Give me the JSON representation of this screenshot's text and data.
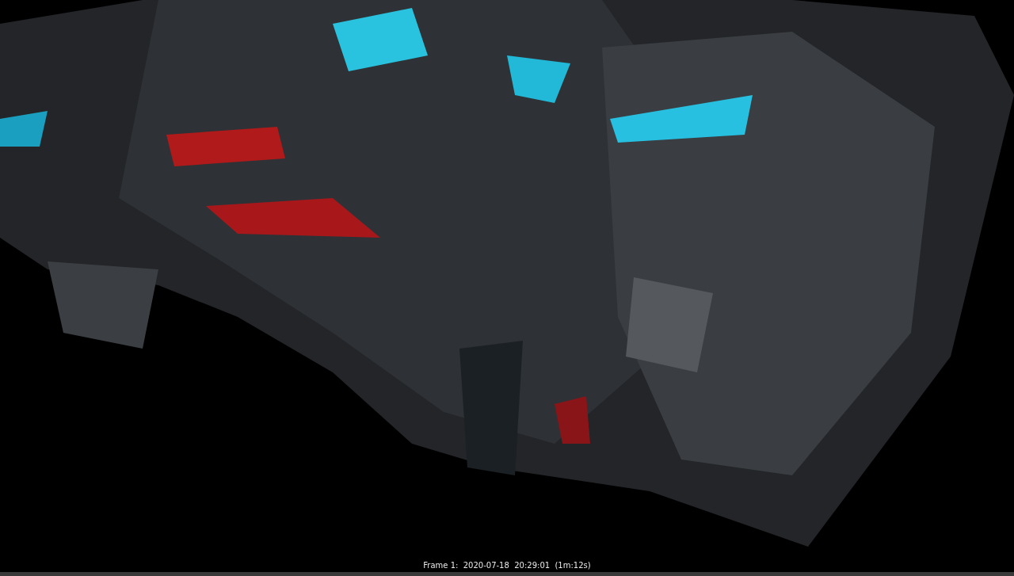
{
  "render_view": {
    "frame_info": "Frame 1:  2020-07-18  20:29:01  (1m:12s)"
  }
}
